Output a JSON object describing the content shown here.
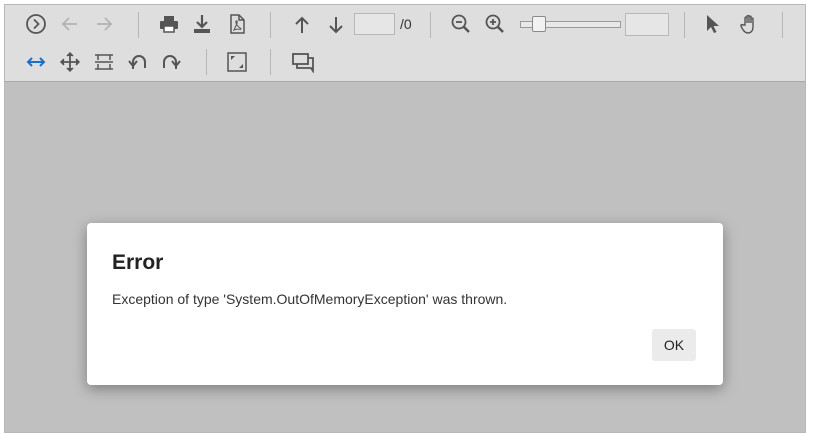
{
  "toolbar": {
    "row1": [
      {
        "name": "next-page-circle-icon"
      },
      {
        "name": "back-arrow-icon"
      },
      {
        "name": "forward-arrow-icon"
      },
      {
        "name": "print-icon"
      },
      {
        "name": "download-icon"
      },
      {
        "name": "pdf-export-icon"
      },
      {
        "name": "previous-page-icon"
      },
      {
        "name": "next-page-icon"
      },
      {
        "name": "zoom-out-icon"
      },
      {
        "name": "zoom-in-icon"
      },
      {
        "name": "select-pointer-icon"
      },
      {
        "name": "pan-hand-icon"
      }
    ],
    "row2": [
      {
        "name": "fit-width-icon"
      },
      {
        "name": "move-icon"
      },
      {
        "name": "page-layout-icon"
      },
      {
        "name": "rotate-left-icon"
      },
      {
        "name": "rotate-right-icon"
      },
      {
        "name": "fullscreen-icon"
      },
      {
        "name": "comments-icon"
      }
    ],
    "page_value": "",
    "page_total": "/0",
    "zoom_value": "",
    "zoom_slider_level": 0.2,
    "accent_color": "#1e6fc8",
    "icon_color": "#555555"
  },
  "dialog": {
    "title": "Error",
    "message": "Exception of type 'System.OutOfMemoryException' was thrown.",
    "ok_label": "OK"
  }
}
